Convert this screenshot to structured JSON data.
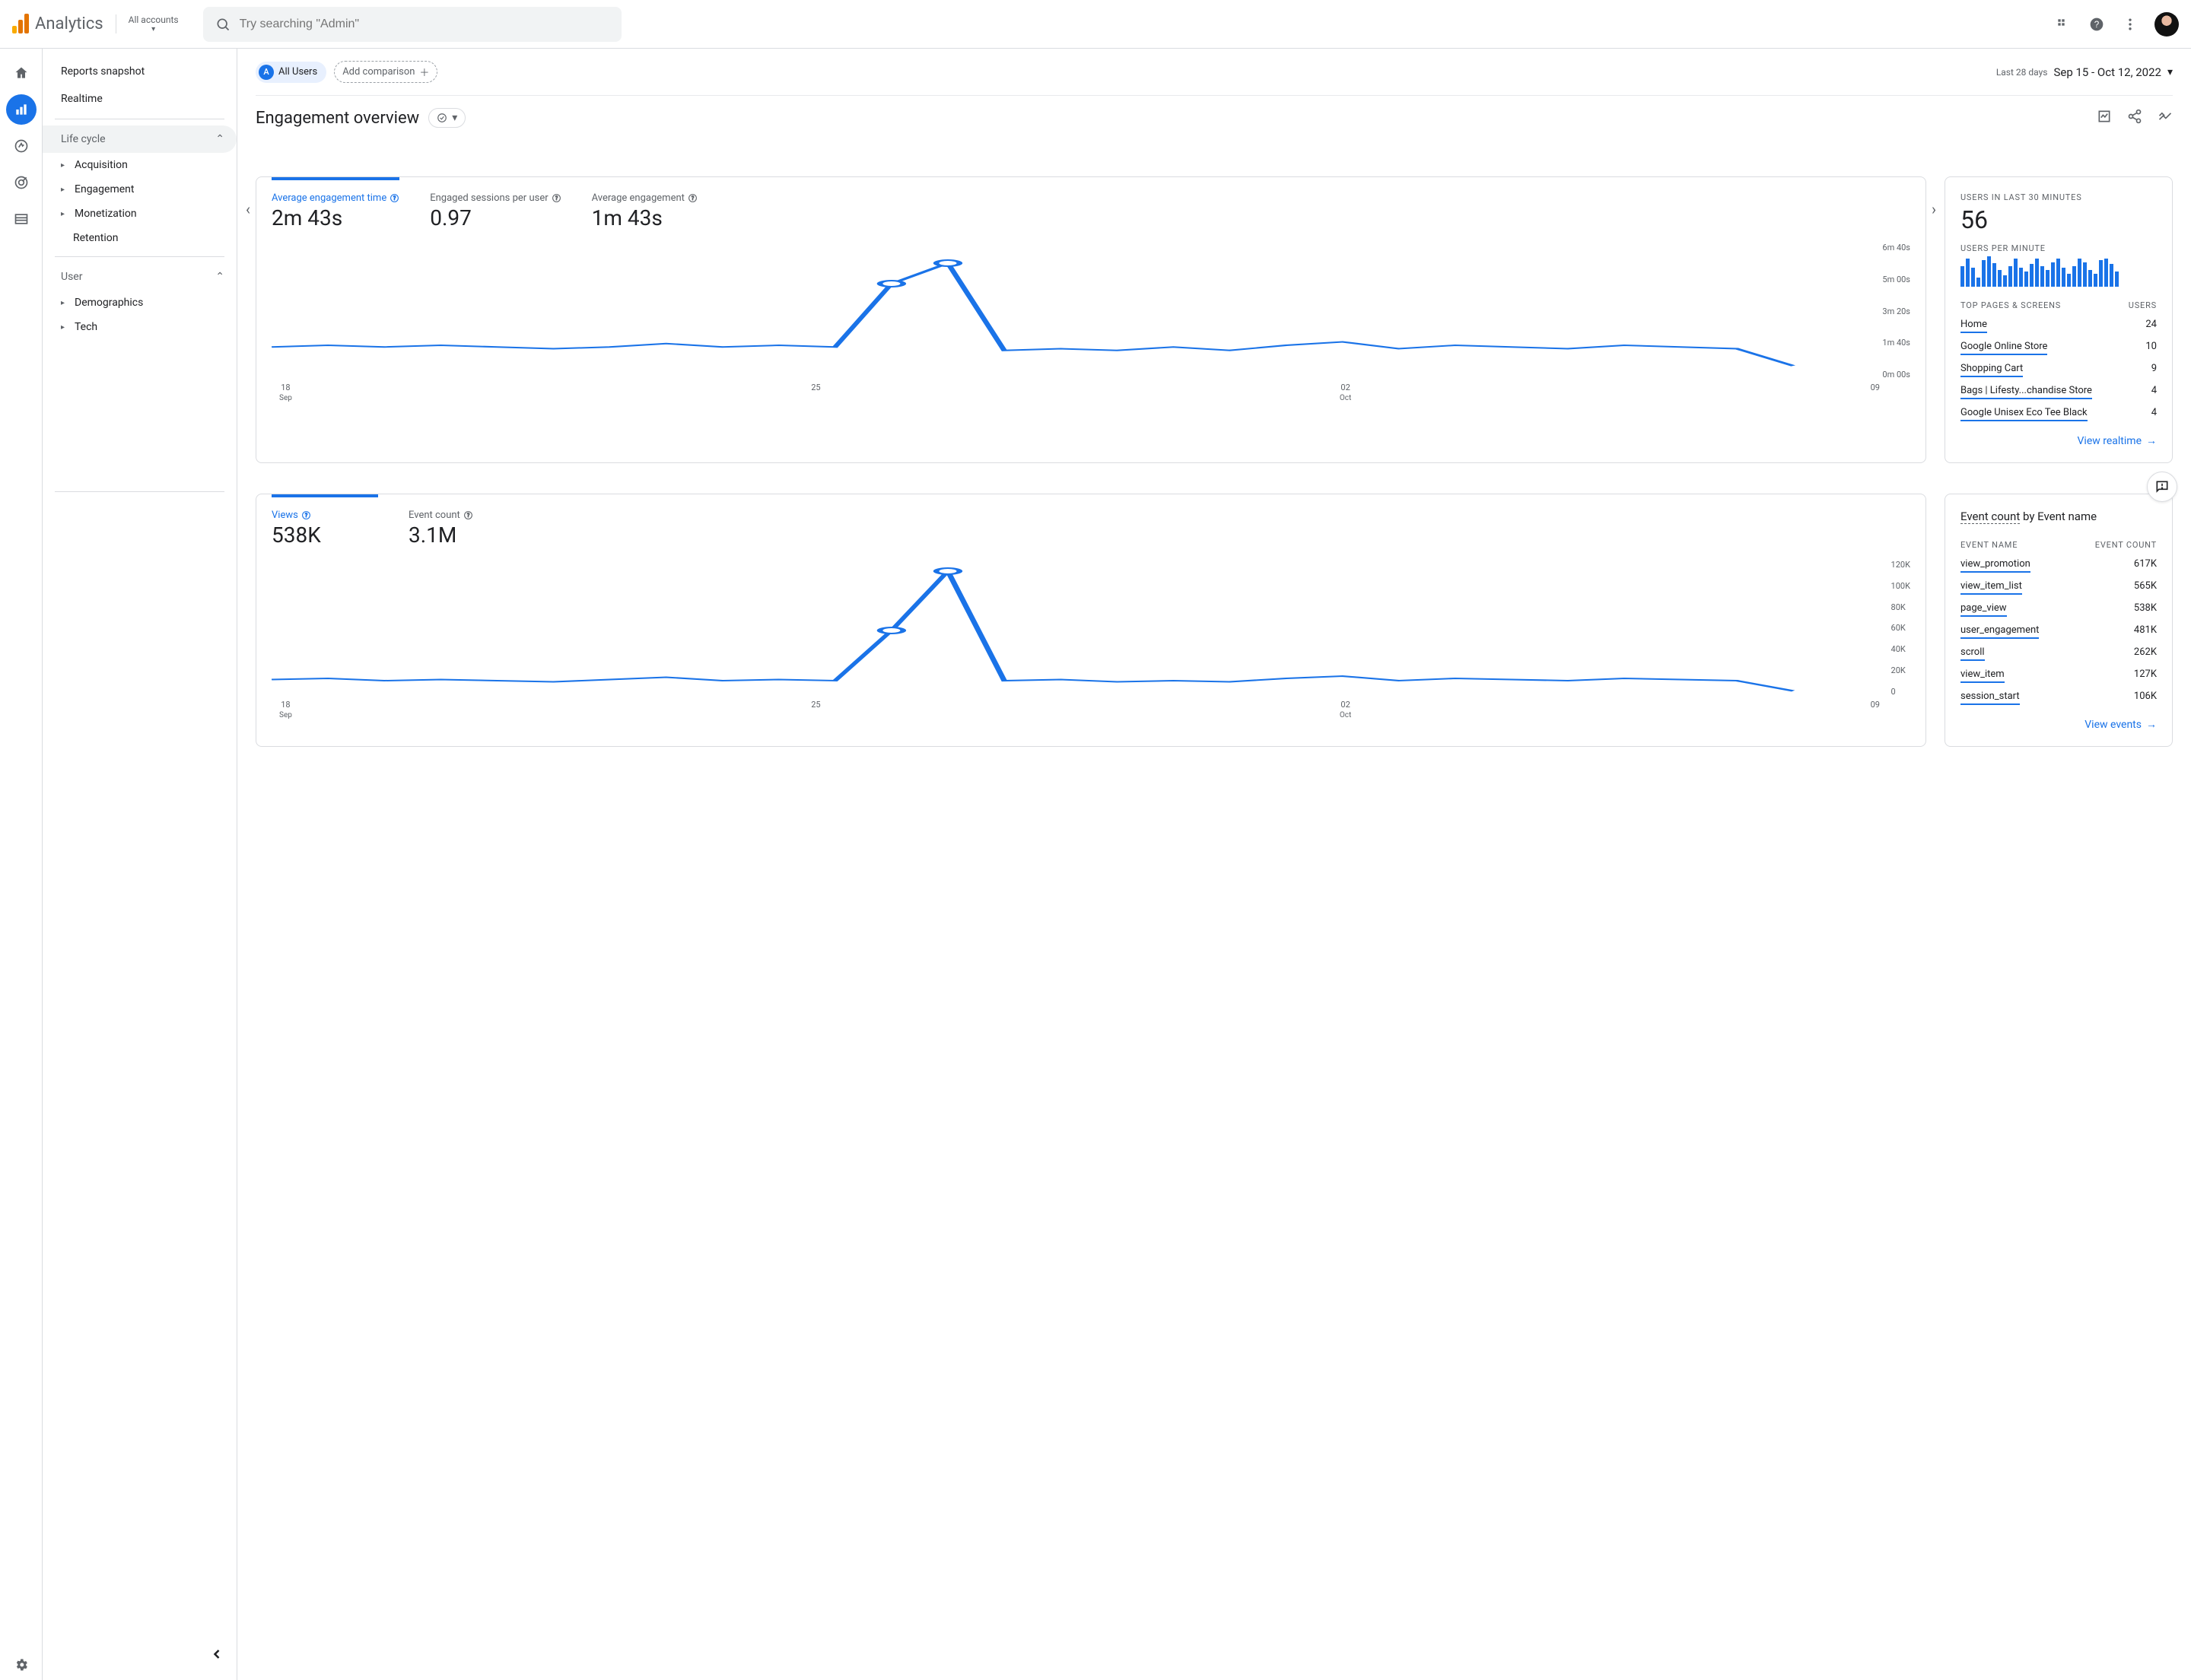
{
  "header": {
    "product": "Analytics",
    "account_label": "All accounts",
    "search_placeholder": "Try searching \"Admin\""
  },
  "sidebar": {
    "snapshot": "Reports snapshot",
    "realtime": "Realtime",
    "lifecycle": {
      "label": "Life cycle",
      "items": [
        "Acquisition",
        "Engagement",
        "Monetization",
        "Retention"
      ]
    },
    "user": {
      "label": "User",
      "items": [
        "Demographics",
        "Tech"
      ]
    }
  },
  "topbar": {
    "all_users_badge": "A",
    "all_users": "All Users",
    "add_comparison": "Add comparison",
    "date_scope": "Last 28 days",
    "date_range": "Sep 15 - Oct 12, 2022"
  },
  "title": "Engagement overview",
  "card1": {
    "metrics": [
      {
        "label": "Average engagement time",
        "value": "2m 43s",
        "active": true
      },
      {
        "label": "Engaged sessions per user",
        "value": "0.97"
      },
      {
        "label": "Average engagement",
        "value": "1m 43s",
        "truncated": true
      }
    ],
    "y_ticks": [
      "6m 40s",
      "5m 00s",
      "3m 20s",
      "1m 40s",
      "0m 00s"
    ],
    "x_ticks": [
      {
        "top": "18",
        "bot": "Sep"
      },
      {
        "top": "25",
        "bot": ""
      },
      {
        "top": "02",
        "bot": "Oct"
      },
      {
        "top": "09",
        "bot": ""
      }
    ]
  },
  "realtime_card": {
    "title": "USERS IN LAST 30 MINUTES",
    "value": "56",
    "upm_label": "USERS PER MINUTE",
    "spark": [
      22,
      30,
      20,
      10,
      28,
      32,
      25,
      18,
      12,
      22,
      30,
      20,
      16,
      24,
      30,
      22,
      18,
      26,
      30,
      20,
      14,
      22,
      30,
      26,
      18,
      14,
      28,
      30,
      24,
      16
    ],
    "table_header": {
      "k": "TOP PAGES & SCREENS",
      "v": "USERS"
    },
    "rows": [
      {
        "k": "Home",
        "v": "24"
      },
      {
        "k": "Google Online Store",
        "v": "10"
      },
      {
        "k": "Shopping Cart",
        "v": "9"
      },
      {
        "k": "Bags | Lifesty...chandise Store",
        "v": "4"
      },
      {
        "k": "Google Unisex Eco Tee Black",
        "v": "4"
      }
    ],
    "link": "View realtime"
  },
  "card2": {
    "metrics": [
      {
        "label": "Views",
        "value": "538K",
        "active": true
      },
      {
        "label": "Event count",
        "value": "3.1M"
      }
    ],
    "y_ticks": [
      "120K",
      "100K",
      "80K",
      "60K",
      "40K",
      "20K",
      "0"
    ],
    "x_ticks": [
      {
        "top": "18",
        "bot": "Sep"
      },
      {
        "top": "25",
        "bot": ""
      },
      {
        "top": "02",
        "bot": "Oct"
      },
      {
        "top": "09",
        "bot": ""
      }
    ]
  },
  "events_card": {
    "title_a": "Event count",
    "title_b": " by Event name",
    "table_header": {
      "k": "EVENT NAME",
      "v": "EVENT COUNT"
    },
    "rows": [
      {
        "k": "view_promotion",
        "v": "617K"
      },
      {
        "k": "view_item_list",
        "v": "565K"
      },
      {
        "k": "page_view",
        "v": "538K"
      },
      {
        "k": "user_engagement",
        "v": "481K"
      },
      {
        "k": "scroll",
        "v": "262K"
      },
      {
        "k": "view_item",
        "v": "127K"
      },
      {
        "k": "session_start",
        "v": "106K"
      }
    ],
    "link": "View events"
  },
  "chart_data": [
    {
      "type": "line",
      "title": "Average engagement time",
      "x": [
        "Sep 15",
        "Sep 16",
        "Sep 17",
        "Sep 18",
        "Sep 19",
        "Sep 20",
        "Sep 21",
        "Sep 22",
        "Sep 23",
        "Sep 24",
        "Sep 25",
        "Sep 26",
        "Sep 27",
        "Sep 28",
        "Sep 29",
        "Sep 30",
        "Oct 01",
        "Oct 02",
        "Oct 03",
        "Oct 04",
        "Oct 05",
        "Oct 06",
        "Oct 07",
        "Oct 08",
        "Oct 09",
        "Oct 10",
        "Oct 11",
        "Oct 12"
      ],
      "series": [
        {
          "name": "Average engagement time (seconds)",
          "values": [
            95,
            100,
            95,
            100,
            95,
            90,
            95,
            105,
            95,
            100,
            95,
            280,
            340,
            85,
            90,
            85,
            95,
            85,
            100,
            110,
            90,
            100,
            95,
            90,
            100,
            95,
            90,
            40
          ]
        }
      ],
      "ylim_seconds": [
        0,
        400
      ],
      "y_tick_labels": [
        "0m 00s",
        "1m 40s",
        "3m 20s",
        "5m 00s",
        "6m 40s"
      ]
    },
    {
      "type": "line",
      "title": "Views",
      "x": [
        "Sep 15",
        "Sep 16",
        "Sep 17",
        "Sep 18",
        "Sep 19",
        "Sep 20",
        "Sep 21",
        "Sep 22",
        "Sep 23",
        "Sep 24",
        "Sep 25",
        "Sep 26",
        "Sep 27",
        "Sep 28",
        "Sep 29",
        "Sep 30",
        "Oct 01",
        "Oct 02",
        "Oct 03",
        "Oct 04",
        "Oct 05",
        "Oct 06",
        "Oct 07",
        "Oct 08",
        "Oct 09",
        "Oct 10",
        "Oct 11",
        "Oct 12"
      ],
      "series": [
        {
          "name": "Views",
          "values": [
            15000,
            16000,
            14000,
            15000,
            14000,
            13000,
            15000,
            17000,
            14000,
            15000,
            14000,
            58000,
            110000,
            14000,
            15000,
            13000,
            14000,
            13000,
            16000,
            18000,
            14000,
            16000,
            15000,
            14000,
            16000,
            15000,
            14000,
            5000
          ]
        }
      ],
      "ylim": [
        0,
        120000
      ]
    },
    {
      "type": "bar",
      "title": "Users per minute",
      "categories": [
        "-30",
        "-29",
        "-28",
        "-27",
        "-26",
        "-25",
        "-24",
        "-23",
        "-22",
        "-21",
        "-20",
        "-19",
        "-18",
        "-17",
        "-16",
        "-15",
        "-14",
        "-13",
        "-12",
        "-11",
        "-10",
        "-9",
        "-8",
        "-7",
        "-6",
        "-5",
        "-4",
        "-3",
        "-2",
        "-1"
      ],
      "values": [
        22,
        30,
        20,
        10,
        28,
        32,
        25,
        18,
        12,
        22,
        30,
        20,
        16,
        24,
        30,
        22,
        18,
        26,
        30,
        20,
        14,
        22,
        30,
        26,
        18,
        14,
        28,
        30,
        24,
        16
      ]
    }
  ]
}
